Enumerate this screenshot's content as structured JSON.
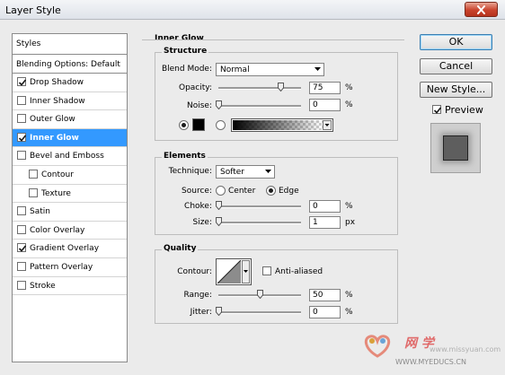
{
  "window": {
    "title": "Layer Style"
  },
  "styles_list": {
    "header": "Styles",
    "blending": "Blending Options: Default",
    "items": [
      {
        "label": "Drop Shadow",
        "checked": true,
        "selected": false,
        "indent": false
      },
      {
        "label": "Inner Shadow",
        "checked": false,
        "selected": false,
        "indent": false
      },
      {
        "label": "Outer Glow",
        "checked": false,
        "selected": false,
        "indent": false
      },
      {
        "label": "Inner Glow",
        "checked": true,
        "selected": true,
        "indent": false
      },
      {
        "label": "Bevel and Emboss",
        "checked": false,
        "selected": false,
        "indent": false
      },
      {
        "label": "Contour",
        "checked": false,
        "selected": false,
        "indent": true
      },
      {
        "label": "Texture",
        "checked": false,
        "selected": false,
        "indent": true
      },
      {
        "label": "Satin",
        "checked": false,
        "selected": false,
        "indent": false
      },
      {
        "label": "Color Overlay",
        "checked": false,
        "selected": false,
        "indent": false
      },
      {
        "label": "Gradient Overlay",
        "checked": true,
        "selected": false,
        "indent": false
      },
      {
        "label": "Pattern Overlay",
        "checked": false,
        "selected": false,
        "indent": false
      },
      {
        "label": "Stroke",
        "checked": false,
        "selected": false,
        "indent": false
      }
    ]
  },
  "inner_glow": {
    "title": "Inner Glow",
    "structure": {
      "title": "Structure",
      "blend_mode_label": "Blend Mode:",
      "blend_mode_value": "Normal",
      "opacity_label": "Opacity:",
      "opacity_value": "75",
      "opacity_unit": "%",
      "opacity_level": 0.75,
      "noise_label": "Noise:",
      "noise_value": "0",
      "noise_unit": "%",
      "noise_level": 0,
      "color_mode": "solid",
      "swatch_color": "#000000"
    },
    "elements": {
      "title": "Elements",
      "technique_label": "Technique:",
      "technique_value": "Softer",
      "source_label": "Source:",
      "source_center": "Center",
      "source_edge": "Edge",
      "source_selected": "edge",
      "choke_label": "Choke:",
      "choke_value": "0",
      "choke_unit": "%",
      "choke_level": 0,
      "size_label": "Size:",
      "size_value": "1",
      "size_unit": "px",
      "size_level": 0.004
    },
    "quality": {
      "title": "Quality",
      "contour_label": "Contour:",
      "anti_aliased_label": "Anti-aliased",
      "anti_aliased": false,
      "range_label": "Range:",
      "range_value": "50",
      "range_unit": "%",
      "range_level": 0.5,
      "jitter_label": "Jitter:",
      "jitter_value": "0",
      "jitter_unit": "%",
      "jitter_level": 0
    }
  },
  "buttons": {
    "ok": "OK",
    "cancel": "Cancel",
    "new_style": "New Style...",
    "preview_label": "Preview",
    "preview_checked": true
  },
  "watermark": {
    "brand": "网 学",
    "url": "WWW.MYEDUCS.CN",
    "site": "www.missyuan.com"
  },
  "colors": {
    "selection": "#3399ff",
    "dialog_bg": "#ebebeb"
  }
}
